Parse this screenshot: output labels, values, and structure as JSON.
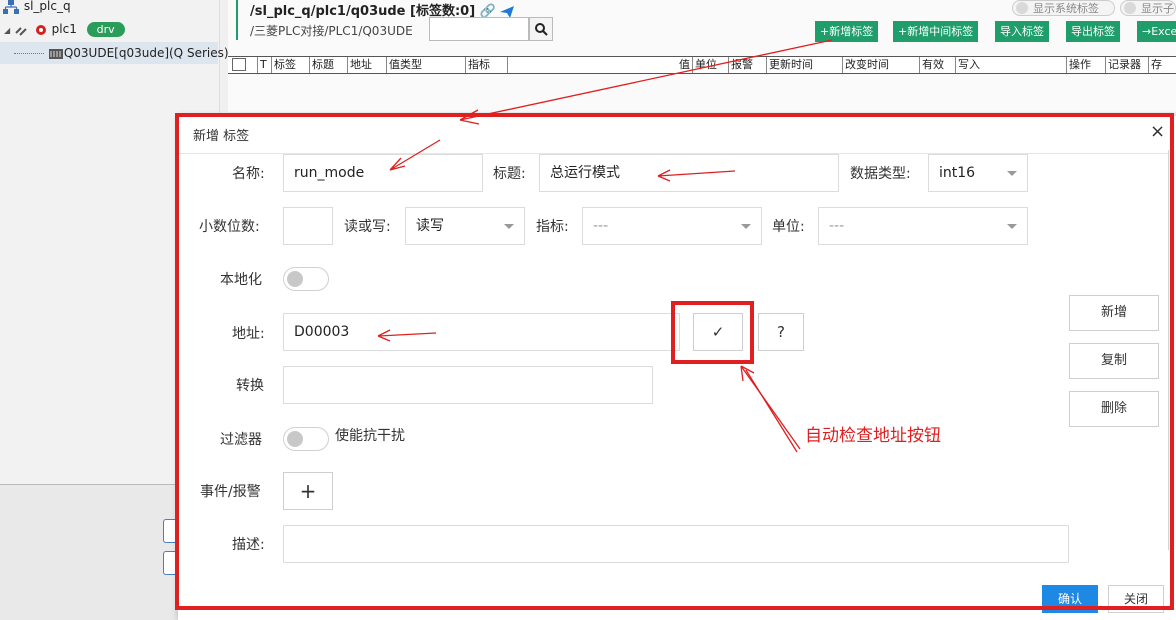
{
  "tree": {
    "root": "sl_plc_q",
    "plc": "plc1",
    "drv_badge": "drv",
    "device": "Q03UDE[q03ude](Q Series)"
  },
  "header": {
    "path_title": "/sl_plc_q/plc1/q03ude [标签数:0]",
    "sub_path": "/三菱PLC对接/PLC1/Q03UDE",
    "search_placeholder": "",
    "show_system_tags": "显示系统标签",
    "show_other": "显示子",
    "buttons": {
      "add_tag": "+新增标签",
      "add_mid_tag": "+新增中间标签",
      "import_tag": "导入标签",
      "export_tag": "导出标签",
      "export_excel": "→Exce"
    }
  },
  "columns": [
    "T",
    "标签",
    "标题",
    "地址",
    "值类型",
    "指标",
    "值",
    "单位",
    "报警",
    "更新时间",
    "改变时间",
    "有效",
    "写入",
    "操作",
    "记录器",
    "存"
  ],
  "dialog": {
    "title": "新增 标签",
    "close_glyph": "×",
    "fields": {
      "name_label": "名称:",
      "name_value": "run_mode",
      "title_label": "标题:",
      "title_value": "总运行模式",
      "datatype_label": "数据类型:",
      "datatype_value": "int16",
      "decimals_label": "小数位数:",
      "decimals_value": "",
      "rw_label": "读或写:",
      "rw_value": "读写",
      "indicator_label": "指标:",
      "indicator_value": "---",
      "unit_label": "单位:",
      "unit_value": "---",
      "localize_label": "本地化",
      "localize_on": false,
      "address_label": "地址:",
      "address_value": "D00003",
      "check_glyph": "✓",
      "help_glyph": "?",
      "transform_label": "转换",
      "transform_value": "",
      "filter_label": "过滤器",
      "filter_on": false,
      "anti_interference_label": "使能抗干扰",
      "event_label": "事件/报警",
      "event_add_glyph": "+",
      "desc_label": "描述:",
      "desc_value": ""
    },
    "side_buttons": {
      "add": "新增",
      "copy": "复制",
      "delete": "删除"
    },
    "footer": {
      "confirm": "确认",
      "close": "关闭"
    }
  },
  "annotation": {
    "text": "自动检查地址按钮",
    "color": "#e02020"
  },
  "colors": {
    "accent_green": "#1f9d6b",
    "primary_blue": "#1e88e5",
    "highlight_red": "#e02020"
  }
}
